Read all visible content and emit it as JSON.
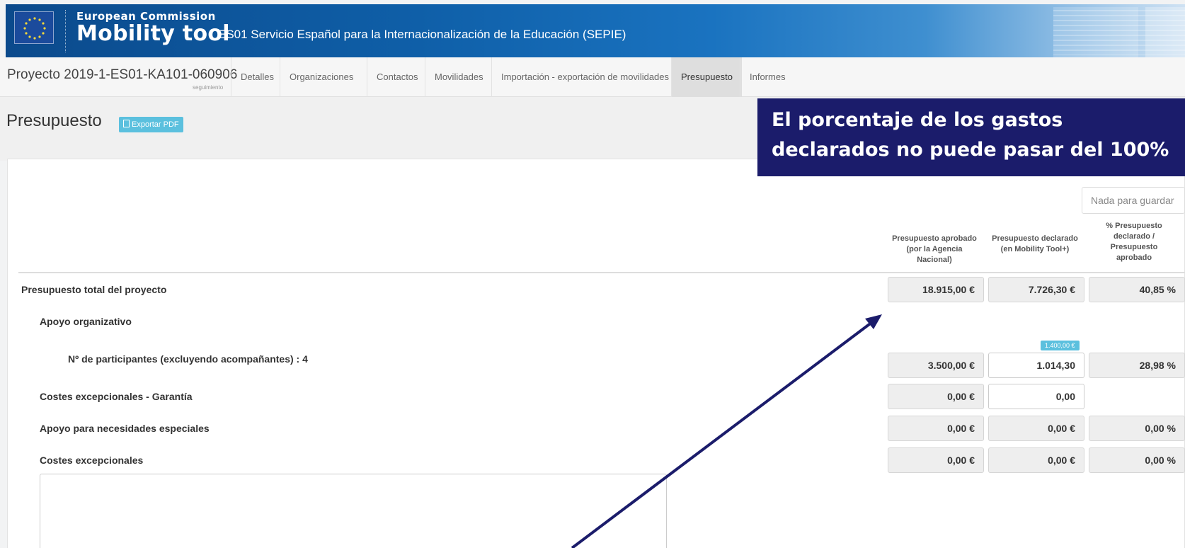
{
  "header": {
    "ec_label": "European Commission",
    "app_name": "Mobility tool",
    "org_name": "ES01 Servicio Español para la Internacionalización de la Educación (SEPIE)"
  },
  "nav": {
    "project_title": "Proyecto 2019-1-ES01-KA101-060906",
    "project_sub": "seguimiento",
    "tabs": [
      {
        "label": "Detalles",
        "active": false
      },
      {
        "label": "Organizaciones",
        "active": false
      },
      {
        "label": "Contactos",
        "active": false
      },
      {
        "label": "Movilidades",
        "active": false
      },
      {
        "label": "Importación - exportación de movilidades",
        "active": false
      },
      {
        "label": "Presupuesto",
        "active": true
      },
      {
        "label": "Informes",
        "active": false
      }
    ]
  },
  "page": {
    "title": "Presupuesto",
    "export_label": "Exportar PDF",
    "save_label": "Nada para guardar"
  },
  "table": {
    "columns": [
      "Presupuesto aprobado (por la Agencia Nacional)",
      "Presupuesto declarado (en Mobility Tool+)",
      "% Presupuesto declarado / Presupuesto aprobado"
    ],
    "rows": [
      {
        "label": "Presupuesto total del proyecto",
        "approved": "18.915,00 €",
        "declared": "7.726,30 €",
        "percent": "40,85 %"
      },
      {
        "label": "Apoyo organizativo"
      },
      {
        "label": "Nº de participantes (excluyendo acompañantes) : 4",
        "hint": "1.400,00 €",
        "approved": "3.500,00 €",
        "declared": "1.014,30",
        "percent": "28,98 %"
      },
      {
        "label": "Costes excepcionales - Garantía",
        "approved": "0,00 €",
        "declared": "0,00"
      },
      {
        "label": "Apoyo para necesidades especiales",
        "approved": "0,00 €",
        "declared": "0,00 €",
        "percent": "0,00 %"
      },
      {
        "label": "Costes excepcionales",
        "approved": "0,00 €",
        "declared": "0,00 €",
        "percent": "0,00 %"
      }
    ]
  },
  "callout": {
    "line1": "El porcentaje de los gastos",
    "line2": "declarados no puede pasar del 100%"
  },
  "colors": {
    "callout_bg": "#1b1c6b",
    "accent": "#5bc0de",
    "banner": "#0f5fa8"
  }
}
